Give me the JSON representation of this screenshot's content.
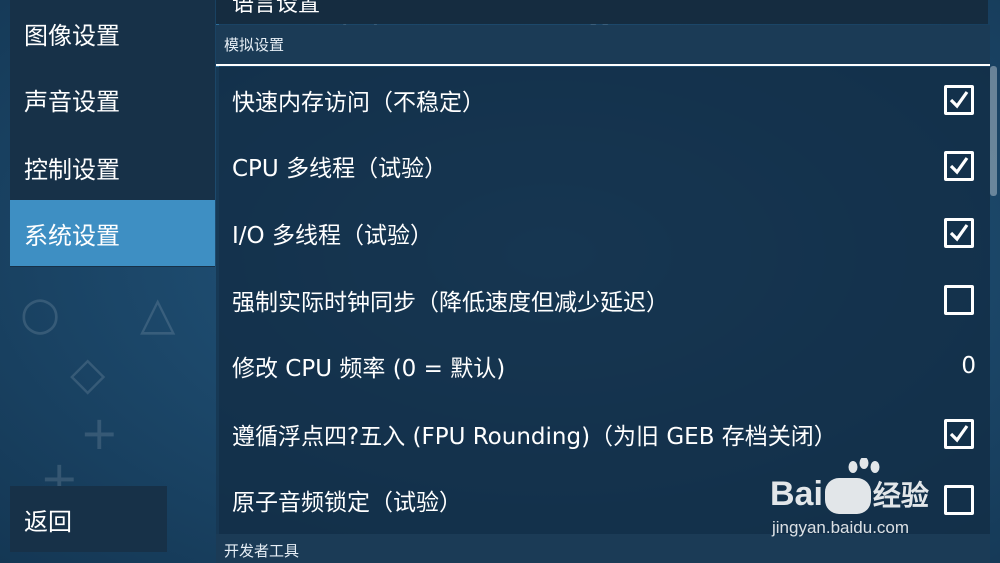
{
  "sidebar": {
    "items": [
      {
        "label": "图像设置"
      },
      {
        "label": "声音设置"
      },
      {
        "label": "控制设置"
      },
      {
        "label": "系统设置"
      }
    ],
    "active_index": 3,
    "back_label": "返回"
  },
  "top_strip_label": "语言设置",
  "sections": [
    {
      "header": "模拟设置"
    },
    {
      "header": "开发者工具"
    }
  ],
  "settings": [
    {
      "label": "快速内存访问（不稳定）",
      "type": "checkbox",
      "checked": true
    },
    {
      "label": "CPU 多线程（试验）",
      "type": "checkbox",
      "checked": true
    },
    {
      "label": "I/O 多线程（试验）",
      "type": "checkbox",
      "checked": true
    },
    {
      "label": "强制实际时钟同步（降低速度但减少延迟）",
      "type": "checkbox",
      "checked": false
    },
    {
      "label": "修改 CPU 频率 (0 = 默认)",
      "type": "value",
      "value": "0"
    },
    {
      "label": "遵循浮点四?五入 (FPU Rounding)（为旧 GEB 存档关闭）",
      "type": "checkbox",
      "checked": true
    },
    {
      "label": "原子音频锁定（试验）",
      "type": "checkbox",
      "checked": false
    }
  ],
  "watermark": {
    "brand": "Bai",
    "brand_suffix": "经验",
    "url": "jingyan.baidu.com"
  },
  "colors": {
    "accent": "#3e8fc3",
    "background": "#1d4a6d",
    "panel": "#122d46"
  }
}
